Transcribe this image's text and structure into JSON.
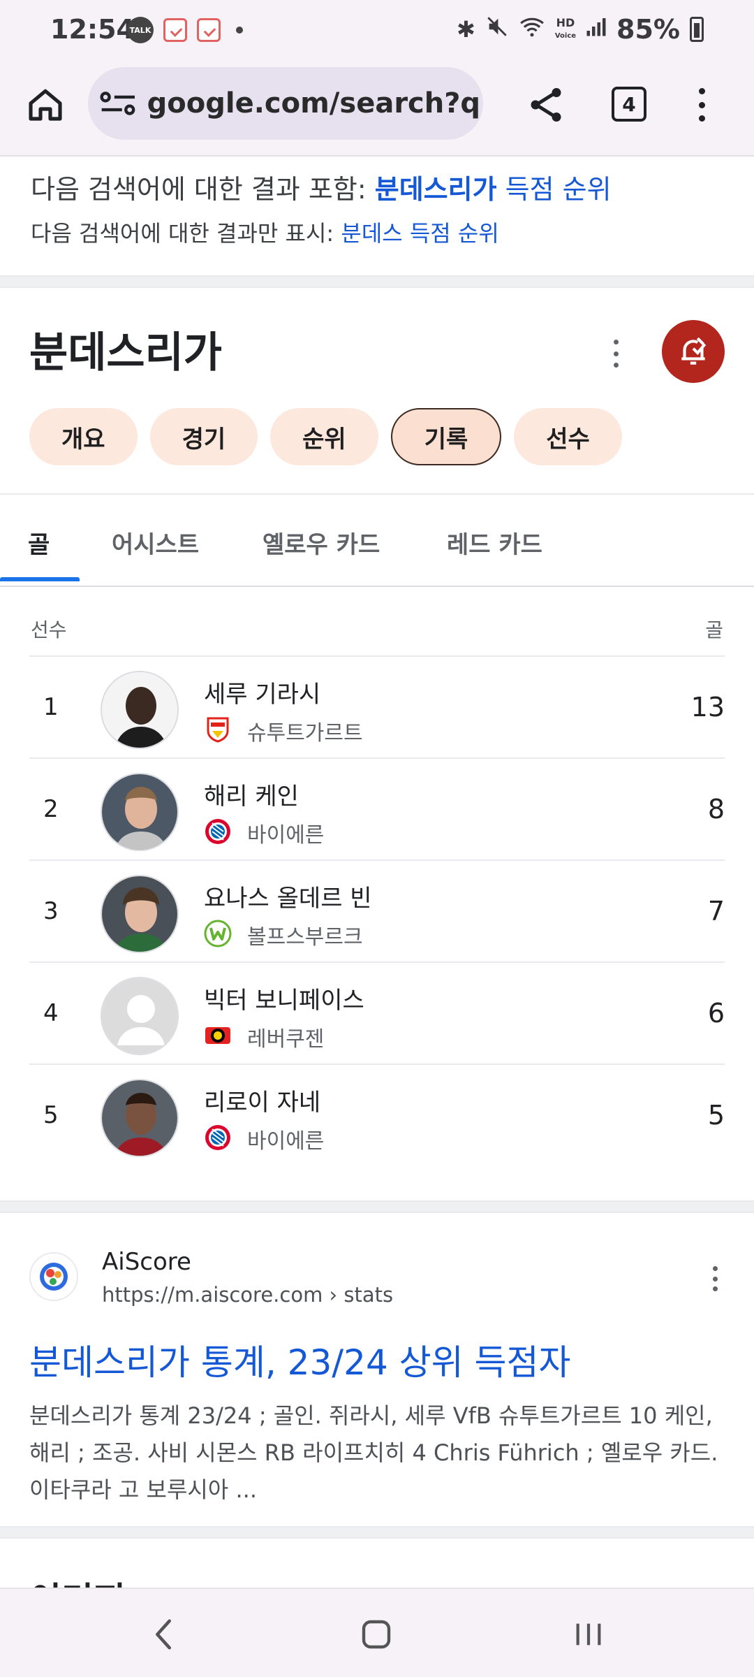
{
  "status_bar": {
    "time": "12:54",
    "talk_label": "TALK",
    "hd_label": "HD",
    "voice_label": "Voice",
    "battery": "85%"
  },
  "browser": {
    "url": "google.com/search?q=",
    "tab_count": "4"
  },
  "spell": {
    "prefix": "다음 검색어에 대한 결과 포함: ",
    "corrected_bold": "분데스리가",
    "corrected_rest": " 득점 순위",
    "only_prefix": "다음 검색어에 대한 결과만 표시: ",
    "only_link": "분데스 득점 순위"
  },
  "entity": {
    "title": "분데스리가",
    "chips": [
      "개요",
      "경기",
      "순위",
      "기록",
      "선수"
    ],
    "active_chip": "기록"
  },
  "stat_tabs": [
    "골",
    "어시스트",
    "옐로우 카드",
    "레드 카드"
  ],
  "table": {
    "col_player": "선수",
    "col_goals": "골",
    "rows": [
      {
        "rank": "1",
        "name": "세루 기라시",
        "club": "슈투트가르트",
        "goals": "13"
      },
      {
        "rank": "2",
        "name": "해리 케인",
        "club": "바이에른",
        "goals": "8"
      },
      {
        "rank": "3",
        "name": "요나스 올데르 빈",
        "club": "볼프스부르크",
        "goals": "7"
      },
      {
        "rank": "4",
        "name": "빅터 보니페이스",
        "club": "레버쿠젠",
        "goals": "6"
      },
      {
        "rank": "5",
        "name": "리로이 자네",
        "club": "바이에른",
        "goals": "5"
      }
    ]
  },
  "result": {
    "site": "AiScore",
    "url": "https://m.aiscore.com › stats",
    "title": "분데스리가 통계, 23/24 상위 득점자",
    "snippet": "분데스리가 통계 23/24 ; 골인. 쥐라시, 세루 VfB 슈투트가르트 10 케인, 해리 ; 조공. 사비 시몬스 RB 라이프치히 4 Chris Führich ; 옐로우 카드. 이타쿠라 고 보루시아 ..."
  },
  "next_section": "이미지",
  "colors": {
    "accent_blue": "#1a73e8",
    "link_blue": "#1558d6",
    "alert_red": "#b3261e",
    "chip_bg": "#fde8de"
  }
}
